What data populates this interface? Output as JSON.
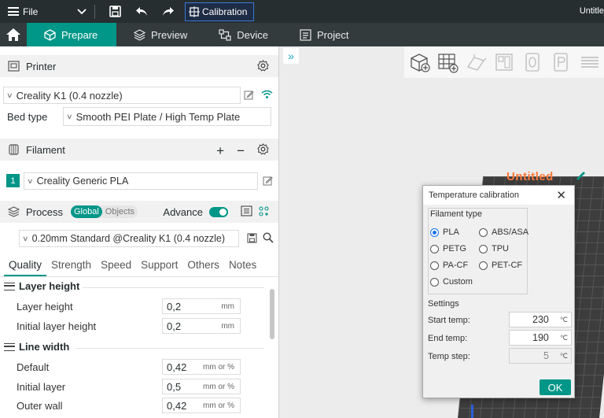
{
  "titlebar": {
    "file_label": "File",
    "calibration_label": "Calibration",
    "window_title": "Untitle"
  },
  "tabs": [
    {
      "label": "Prepare",
      "icon": "cube-icon"
    },
    {
      "label": "Preview",
      "icon": "layers-icon"
    },
    {
      "label": "Device",
      "icon": "device-icon"
    },
    {
      "label": "Project",
      "icon": "project-icon"
    }
  ],
  "printer": {
    "section_label": "Printer",
    "selected": "Creality K1 (0.4 nozzle)",
    "bed_type_label": "Bed type",
    "bed_type_value": "Smooth PEI Plate / High Temp Plate"
  },
  "filament": {
    "section_label": "Filament",
    "slot_number": "1",
    "selected": "Creality Generic PLA"
  },
  "process": {
    "section_label": "Process",
    "toggle_global": "Global",
    "toggle_objects": "Objects",
    "advance_label": "Advance",
    "preset": "0.20mm Standard @Creality K1 (0.4 nozzle)"
  },
  "quality_tabs": [
    "Quality",
    "Strength",
    "Speed",
    "Support",
    "Others",
    "Notes"
  ],
  "groups": {
    "layer_height": {
      "title": "Layer height",
      "options": [
        {
          "label": "Layer height",
          "value": "0,2",
          "unit": "mm"
        },
        {
          "label": "Initial layer height",
          "value": "0,2",
          "unit": "mm"
        }
      ]
    },
    "line_width": {
      "title": "Line width",
      "options": [
        {
          "label": "Default",
          "value": "0,42",
          "unit": "mm or %"
        },
        {
          "label": "Initial layer",
          "value": "0,5",
          "unit": "mm or %"
        },
        {
          "label": "Outer wall",
          "value": "0,42",
          "unit": "mm or %"
        }
      ]
    }
  },
  "viewport": {
    "plate_name": "Untitled"
  },
  "dialog": {
    "title": "Temperature calibration",
    "filament_type_label": "Filament type",
    "filament_types": [
      "PLA",
      "ABS/ASA",
      "PETG",
      "TPU",
      "PA-CF",
      "PET-CF",
      "Custom"
    ],
    "selected_filament_type": "PLA",
    "settings_label": "Settings",
    "start_temp_label": "Start temp:",
    "start_temp_value": "230",
    "end_temp_label": "End temp:",
    "end_temp_value": "190",
    "temp_step_label": "Temp step:",
    "temp_step_value": "5",
    "temp_unit": "℃",
    "ok_label": "OK"
  },
  "colors": {
    "accent": "#009688",
    "titlebar": "#262e30",
    "plate_name": "#ff7a3d"
  }
}
